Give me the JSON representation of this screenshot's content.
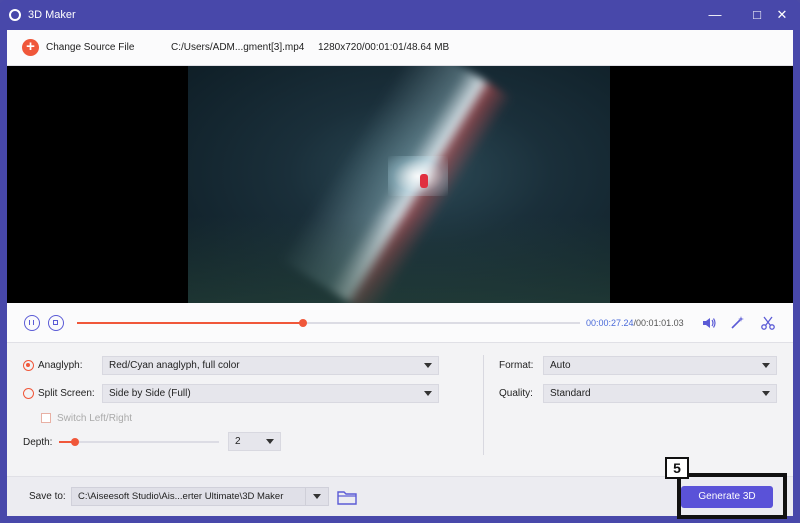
{
  "window": {
    "title": "3D Maker",
    "controls": [
      "minimize-icon",
      "maximize-icon",
      "close-icon"
    ]
  },
  "toolbar": {
    "change_source_label": "Change Source File",
    "file_path": "C:/Users/ADM...gment[3].mp4",
    "file_info": "1280x720/00:01:01/48.64 MB"
  },
  "player": {
    "current_time": "00:00:27.24",
    "total_time": "/00:01:01.03",
    "progress_fraction": 0.45
  },
  "settings": {
    "anaglyph_label": "Anaglyph:",
    "anaglyph_value": "Red/Cyan anaglyph, full color",
    "split_screen_label": "Split Screen:",
    "split_screen_value": "Side by Side (Full)",
    "switch_label": "Switch Left/Right",
    "depth_label": "Depth:",
    "depth_value": "2",
    "depth_fraction": 0.1,
    "format_label": "Format:",
    "format_value": "Auto",
    "quality_label": "Quality:",
    "quality_value": "Standard"
  },
  "footer": {
    "save_to_label": "Save to:",
    "save_path": "C:\\Aiseesoft Studio\\Ais...erter Ultimate\\3D Maker",
    "generate_label": "Generate 3D"
  },
  "callout": {
    "number": "5"
  },
  "colors": {
    "accent": "#f0573a",
    "primary": "#5a52d8",
    "frame": "#4848aa"
  }
}
